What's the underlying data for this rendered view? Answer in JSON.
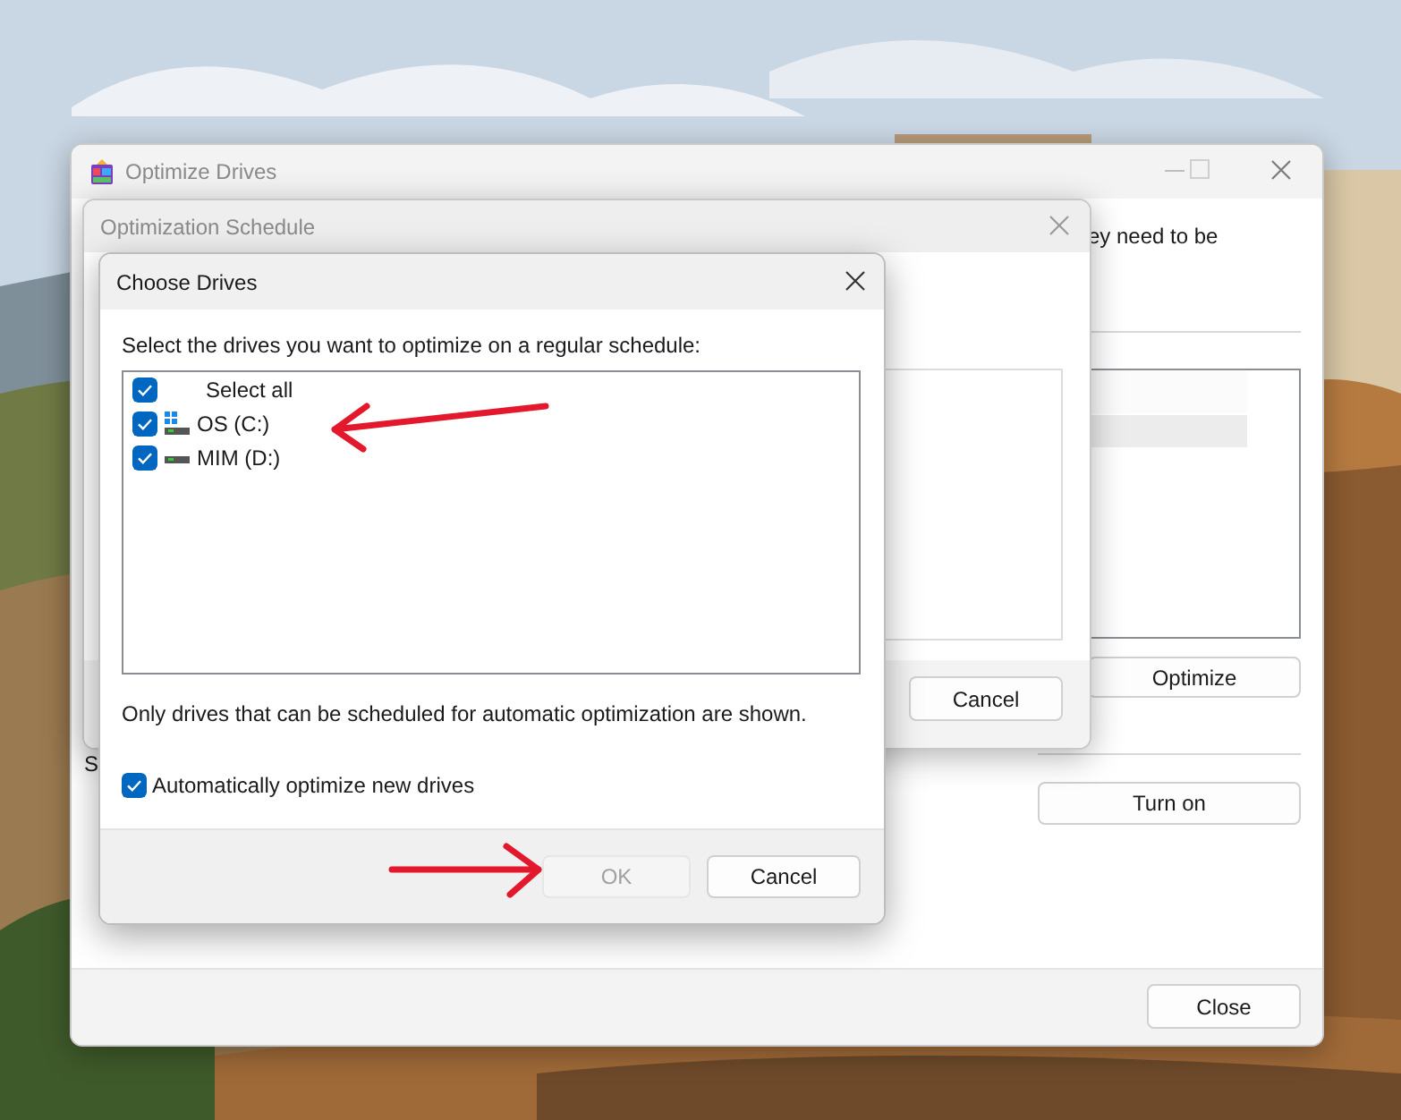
{
  "main_window": {
    "title": "Optimize Drives",
    "text_fragment": "ey need to be",
    "drive_list_rows": [
      {
        "selected": false
      },
      {
        "selected": true
      }
    ],
    "optimize_button": "Optimize",
    "section_letter": "S",
    "turn_on_button": "Turn on",
    "close_button": "Close"
  },
  "schedule_dialog": {
    "title": "Optimization Schedule",
    "cancel_button": "Cancel"
  },
  "choose_dialog": {
    "title": "Choose Drives",
    "prompt": "Select the drives you want to optimize on a regular schedule:",
    "drives": [
      {
        "kind": "all",
        "label": "Select all",
        "checked": true
      },
      {
        "kind": "system",
        "label": "OS (C:)",
        "checked": true
      },
      {
        "kind": "data",
        "label": "MIM (D:)",
        "checked": true
      }
    ],
    "note": "Only drives that can be scheduled for automatic optimization are shown.",
    "auto_optimize": {
      "label": "Automatically optimize new drives",
      "checked": true
    },
    "ok_button": {
      "label": "OK",
      "disabled": true
    },
    "cancel_button": "Cancel"
  }
}
